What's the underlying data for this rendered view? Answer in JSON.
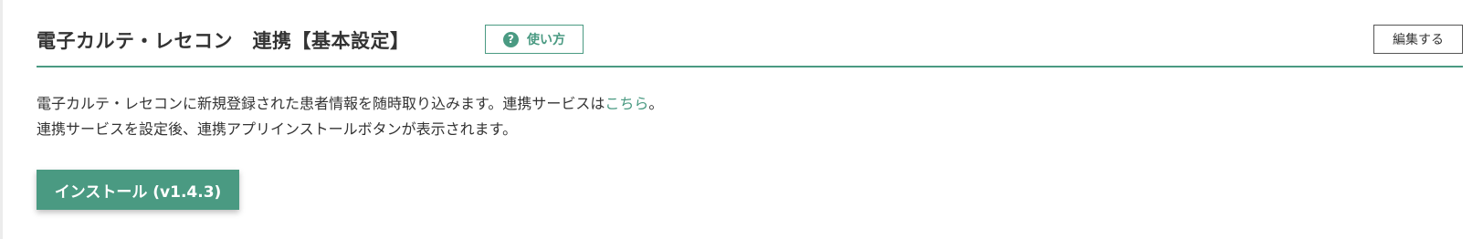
{
  "header": {
    "title": "電子カルテ・レセコン　連携【基本設定】",
    "help_button": {
      "icon_glyph": "?",
      "icon": "question-circle-icon",
      "label": "使い方"
    },
    "edit_button_label": "編集する"
  },
  "description": {
    "line1_text": "電子カルテ・レセコンに新規登録された患者情報を随時取り込みます。連携サービスは",
    "line1_link": "こちら",
    "line1_suffix": "。",
    "line2_text": "連携サービスを設定後、連携アプリインストールボタンが表示されます。"
  },
  "install_button_label": "インストール (v1.4.3)",
  "colors": {
    "accent": "#4a9a82",
    "text": "#333333",
    "border": "#555555"
  }
}
